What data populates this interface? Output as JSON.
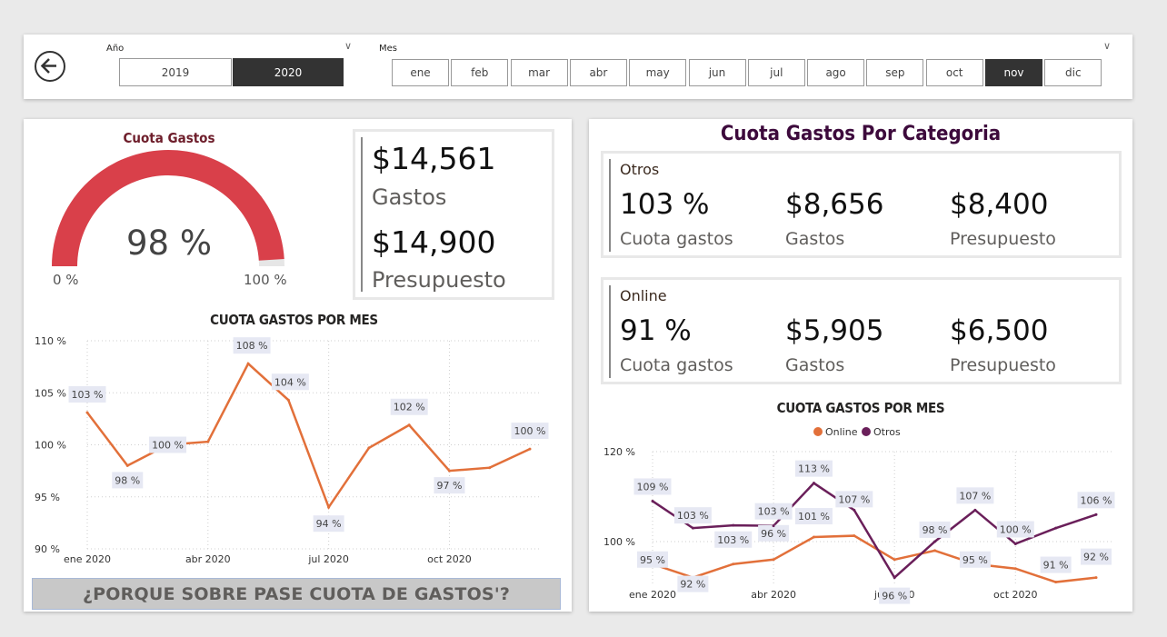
{
  "slicers": {
    "year": {
      "title": "Año",
      "options": [
        "2019",
        "2020"
      ],
      "selected": "2020"
    },
    "month": {
      "title": "Mes",
      "options": [
        "ene",
        "feb",
        "mar",
        "abr",
        "may",
        "jun",
        "jul",
        "ago",
        "sep",
        "oct",
        "nov",
        "dic"
      ],
      "selected": "nov"
    }
  },
  "gauge": {
    "title": "Cuota Gastos",
    "value_label": "98 %",
    "value": 0.98,
    "min_label": "0 %",
    "max_label": "100 %",
    "color": "#d9404a",
    "track_color": "#e6e6e6"
  },
  "kpi": {
    "gastos_value": "$14,561",
    "gastos_label": "Gastos",
    "presupuesto_value": "$14,900",
    "presupuesto_label": "Presupuesto"
  },
  "banner": {
    "text": "¿PORQUE SOBRE PASE CUOTA DE GASTOS'?"
  },
  "category": {
    "title": "Cuota Gastos Por Categoria",
    "title_color": "#3d0a3c",
    "otros": {
      "name": "Otros",
      "cuota_value": "103 %",
      "cuota_label": "Cuota gastos",
      "gastos_value": "$8,656",
      "gastos_label": "Gastos",
      "presupuesto_value": "$8,400",
      "presupuesto_label": "Presupuesto"
    },
    "online": {
      "name": "Online",
      "cuota_value": "91 %",
      "cuota_label": "Cuota gastos",
      "gastos_value": "$5,905",
      "gastos_label": "Gastos",
      "presupuesto_value": "$6,500",
      "presupuesto_label": "Presupuesto"
    }
  },
  "chart_data": [
    {
      "type": "line",
      "title": "CUOTA GASTOS POR MES",
      "x_ticks": [
        "ene 2020",
        "abr 2020",
        "jul 2020",
        "oct 2020"
      ],
      "y_ticks": [
        "110 %",
        "105 %",
        "100 %",
        "95 %",
        "90 %"
      ],
      "ylim": [
        90,
        110
      ],
      "grid": true,
      "series": [
        {
          "color": "#e2703a",
          "values": [
            103.1,
            98.0,
            100.0,
            100.3,
            107.8,
            104.3,
            94.0,
            99.7,
            101.9,
            97.5,
            97.8,
            99.6
          ],
          "data_labels": [
            "103 %",
            "98 %",
            "100 %",
            "",
            "108 %",
            "104 %",
            "94 %",
            "",
            "102 %",
            "97 %",
            "",
            "100 %"
          ]
        }
      ]
    },
    {
      "type": "line",
      "title": "CUOTA GASTOS POR MES",
      "legend": [
        "Online",
        "Otros"
      ],
      "legend_position": "top",
      "x_ticks": [
        "ene 2020",
        "abr 2020",
        "jul 2020",
        "oct 2020"
      ],
      "y_ticks": [
        "120 %",
        "100 %"
      ],
      "grid": true,
      "series": [
        {
          "name": "Online",
          "color": "#e2703a",
          "values": [
            95.0,
            92.0,
            95.0,
            96.0,
            101.0,
            101.3,
            96.0,
            98.0,
            95.0,
            94.0,
            91.0,
            92.0
          ],
          "data_labels": [
            "95 %",
            "92 %",
            "103 %",
            "96 %",
            "101 %",
            "",
            "",
            "98 %",
            "95 %",
            "",
            "91 %",
            "92 %"
          ]
        },
        {
          "name": "Otros",
          "color": "#6a1f5a",
          "values": [
            109.0,
            103.0,
            103.6,
            103.5,
            113.0,
            107.0,
            92.0,
            100.0,
            107.0,
            99.5,
            103.0,
            106.0
          ],
          "data_labels": [
            "109 %",
            "103 %",
            "",
            "103 %",
            "113 %",
            "107 %",
            "96 %",
            "",
            "107 %",
            "100 %",
            "",
            "106 %"
          ]
        }
      ]
    }
  ]
}
